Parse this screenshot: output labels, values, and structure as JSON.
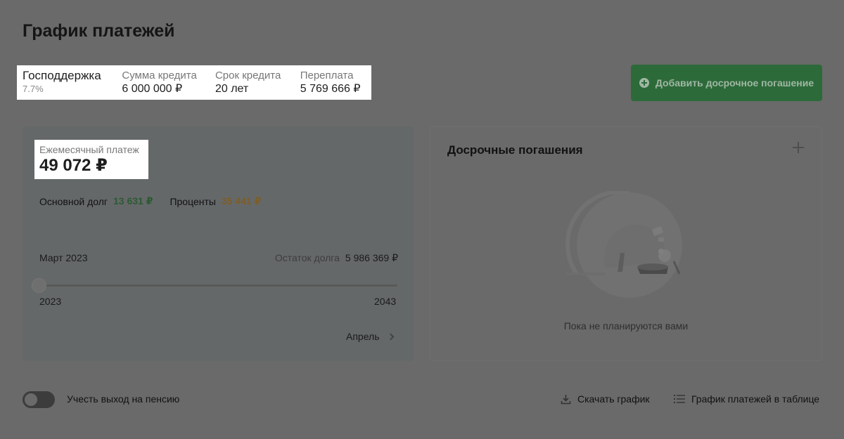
{
  "page": {
    "title": "График платежей"
  },
  "summary": {
    "program_label": "Господдержка",
    "program_rate": "7.7%",
    "amount_label": "Сумма кредита",
    "amount_value": "6 000 000 ₽",
    "term_label": "Срок кредита",
    "term_value": "20 лет",
    "overpay_label": "Переплата",
    "overpay_value": "5 769 666 ₽"
  },
  "add_button": {
    "label": "Добавить досрочное погашение"
  },
  "payment": {
    "monthly_label": "Ежемесячный платеж",
    "monthly_value": "49 072 ₽",
    "principal_label": "Основной долг",
    "principal_value": "13 631 ₽",
    "interest_label": "Проценты",
    "interest_value": "35 441 ₽",
    "month_label": "Март 2023",
    "balance_label": "Остаток долга",
    "balance_value": "5 986 369 ₽",
    "slider_position": 0.0,
    "year_start": "2023",
    "year_end": "2043",
    "next_label": "Апрель"
  },
  "early_payments": {
    "title": "Досрочные погашения",
    "empty_text": "Пока не планируются вами"
  },
  "footer": {
    "retirement_toggle_label": "Учесть выход на пенсию",
    "retirement_toggle_on": false,
    "download_label": "Скачать график",
    "table_label": "График платежей в таблице"
  },
  "colors": {
    "accent_green": "#2d6a3a",
    "principal": "#2c5a34",
    "interest": "#7d5e25"
  },
  "icons": {
    "add": "plus-circle-icon",
    "add_early": "plus-icon",
    "next": "chevron-right-icon",
    "download": "download-icon",
    "table": "list-icon"
  }
}
